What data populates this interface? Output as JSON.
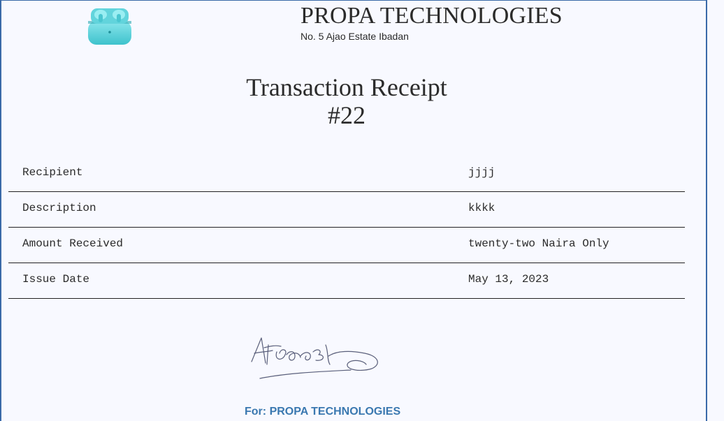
{
  "company": {
    "name": "PROPA TECHNOLOGIES",
    "address": "No. 5 Ajao Estate Ibadan"
  },
  "receipt": {
    "title": "Transaction Receipt",
    "number": "#22"
  },
  "details": [
    {
      "label": "Recipient",
      "value": "jjjj"
    },
    {
      "label": "Description",
      "value": "kkkk"
    },
    {
      "label": "Amount Received",
      "value": "twenty-two Naira Only"
    },
    {
      "label": "Issue Date",
      "value": "May 13, 2023"
    }
  ],
  "footer": {
    "for_prefix": "For:",
    "for_company": "PROPA TECHNOLOGIES"
  },
  "icons": {
    "logo": "earbuds-case-icon"
  },
  "colors": {
    "background": "#f8f9ff",
    "frame": "#3a6aa8",
    "for_text": "#3a78b0",
    "logo": "#5fd3dc"
  }
}
